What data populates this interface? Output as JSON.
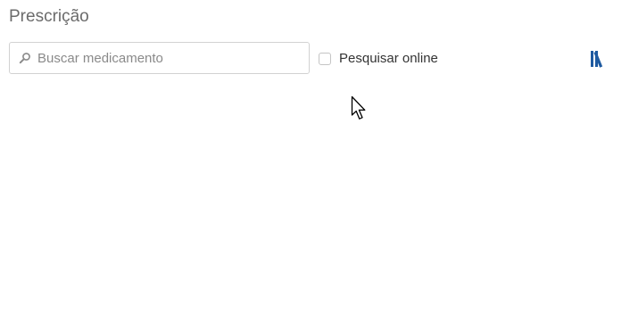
{
  "section": {
    "title": "Prescrição"
  },
  "search": {
    "placeholder": "Buscar medicamento",
    "value": "",
    "icon": "search-icon"
  },
  "online_search": {
    "label": "Pesquisar online",
    "checked": false
  },
  "library_button": {
    "icon": "library-books-icon",
    "color": "#1e5aa0"
  },
  "colors": {
    "title": "#6b6b6b",
    "text": "#333333",
    "border": "#d2d2d2",
    "accent": "#1e5aa0"
  }
}
